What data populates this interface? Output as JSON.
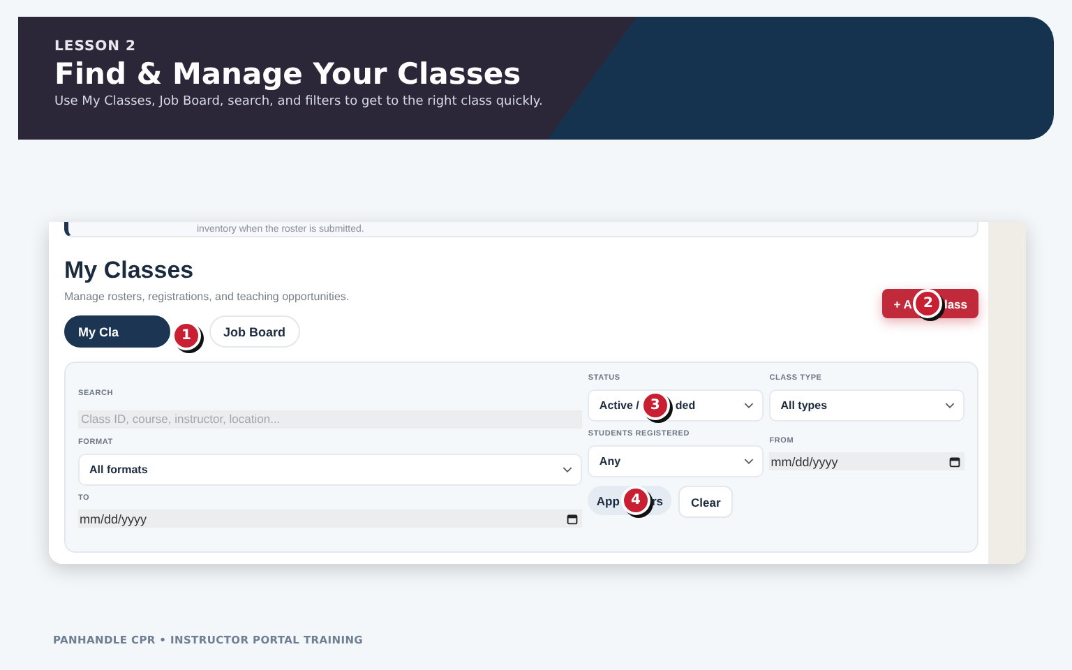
{
  "lesson": {
    "eyebrow": "LESSON 2",
    "title": "Find & Manage Your Classes",
    "subtitle": "Use My Classes, Job Board, search, and filters to get to the right class quickly."
  },
  "screenshot": {
    "notice": "inventory when the roster is submitted.",
    "heading": "My Classes",
    "description": "Manage rosters, registrations, and teaching opportunities.",
    "add_button": {
      "label_before": "+ A",
      "badge": "2",
      "label_after": "lass"
    },
    "tabs": [
      {
        "label": "My Cla",
        "selected": true,
        "badge": "1"
      },
      {
        "label": "Job Board",
        "selected": false
      }
    ],
    "filters": {
      "search": {
        "label": "SEARCH",
        "placeholder": "Class ID, course, instructor, location..."
      },
      "format": {
        "label": "FORMAT",
        "value": "All formats"
      },
      "to": {
        "label": "TO",
        "placeholder": "mm/dd/yyyy"
      },
      "status": {
        "label": "STATUS",
        "value_before": "Active /",
        "badge": "3",
        "value_after": "ded"
      },
      "students": {
        "label": "STUDENTS REGISTERED",
        "value": "Any"
      },
      "class_type": {
        "label": "CLASS TYPE",
        "value": "All types"
      },
      "from": {
        "label": "FROM",
        "placeholder": "mm/dd/yyyy"
      },
      "apply_button": {
        "label_before": "App",
        "badge": "4",
        "label_after": "rs"
      },
      "clear_button": {
        "label": "Clear"
      }
    }
  },
  "footer": "PANHANDLE CPR • INSTRUCTOR PORTAL TRAINING"
}
